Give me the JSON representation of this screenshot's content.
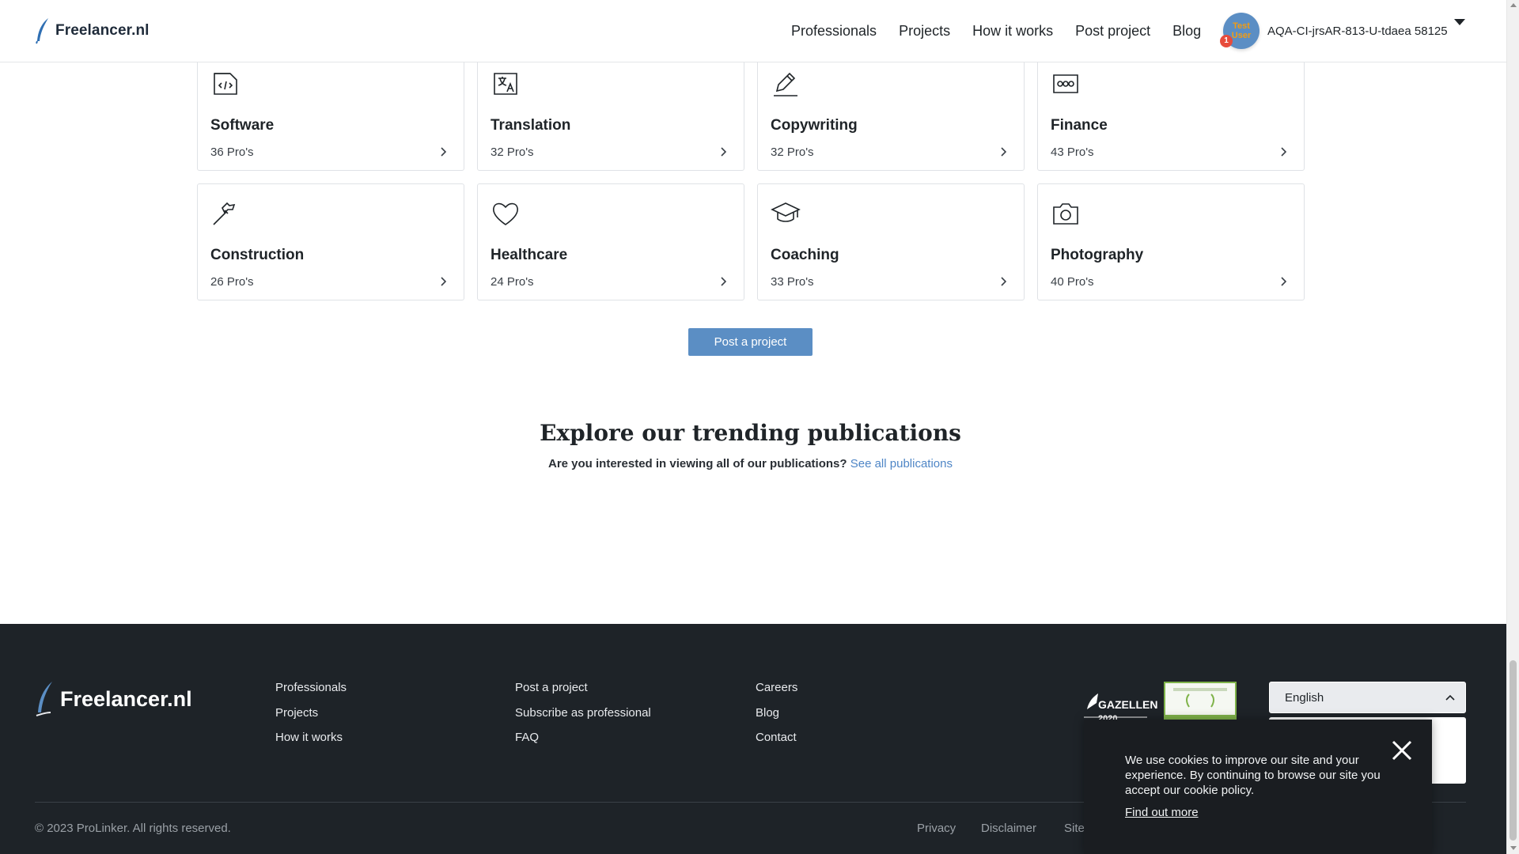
{
  "header": {
    "logo_text": "Freelancer.nl",
    "nav": [
      "Professionals",
      "Projects",
      "How it works",
      "Post project",
      "Blog"
    ],
    "user": {
      "avatar_text": "Test User",
      "notification_count": "1",
      "name": "AQA-CI-jrsAR-813-U-tdaea 58125"
    }
  },
  "categories": [
    {
      "title": "Software",
      "count": "36 Pro's",
      "icon": "code-file-icon"
    },
    {
      "title": "Translation",
      "count": "32 Pro's",
      "icon": "translate-icon"
    },
    {
      "title": "Copywriting",
      "count": "32 Pro's",
      "icon": "pencil-icon"
    },
    {
      "title": "Finance",
      "count": "43 Pro's",
      "icon": "money-bill-icon"
    },
    {
      "title": "Construction",
      "count": "26 Pro's",
      "icon": "hammer-icon"
    },
    {
      "title": "Healthcare",
      "count": "24 Pro's",
      "icon": "heart-icon"
    },
    {
      "title": "Coaching",
      "count": "33 Pro's",
      "icon": "graduation-cap-icon"
    },
    {
      "title": "Photography",
      "count": "40 Pro's",
      "icon": "camera-icon"
    }
  ],
  "post_button": "Post a project",
  "publications": {
    "title": "Explore our trending publications",
    "question": "Are you interested in viewing all of our publications?",
    "link": "See all publications"
  },
  "footer": {
    "logo_text": "Freelancer.nl",
    "col1": [
      "Professionals",
      "Projects",
      "How it works"
    ],
    "col2": [
      "Post a project",
      "Subscribe as professional",
      "FAQ"
    ],
    "col3": [
      "Careers",
      "Blog",
      "Contact"
    ],
    "award1_text": "GAZELLEN",
    "award1_year": "2020",
    "language": "English",
    "copyright": "© 2023 ProLinker. All rights reserved.",
    "legal": [
      "Privacy",
      "Disclaimer",
      "Site"
    ]
  },
  "cookie": {
    "text": "We use cookies to improve our site and your experience. By continuing to browse our site you accept our cookie policy.",
    "link": "Find out more"
  },
  "colors": {
    "accent": "#5b8ec4",
    "link": "#4f86c6",
    "footer_bg": "#1e2328",
    "badge": "#e74c3c"
  }
}
